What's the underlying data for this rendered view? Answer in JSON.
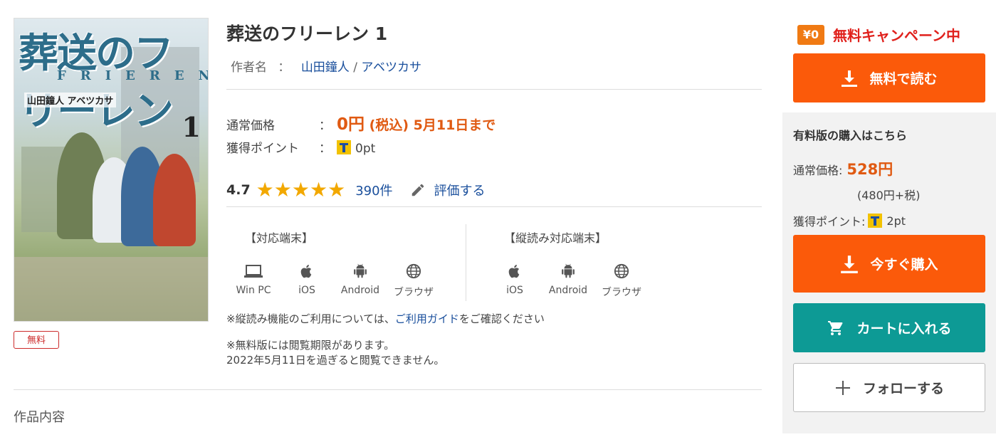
{
  "cover": {
    "title_text": "葬送のフリーレン",
    "title_en": "FRIEREN",
    "author_text": "山田鐘人 アベツカサ",
    "volume_text": "1"
  },
  "badge": {
    "free_label": "無料"
  },
  "book": {
    "title": "葬送のフリーレン 1",
    "author_label": "作者名",
    "author_colon": "：",
    "authors": [
      "山田鐘人",
      "アベツカサ"
    ],
    "author_sep": "/"
  },
  "price": {
    "label": "通常価格",
    "colon": "：",
    "value_main": "0円",
    "value_detail": "(税込) 5月11日まで"
  },
  "points": {
    "label": "獲得ポイント",
    "colon": "：",
    "value": "0pt"
  },
  "rating": {
    "score": "4.7",
    "stars": 4.7,
    "count": "390件",
    "rate_label": "評価する"
  },
  "devices": {
    "heading": "【対応端末】",
    "items": [
      {
        "icon": "laptop-icon",
        "label": "Win PC"
      },
      {
        "icon": "apple-icon",
        "label": "iOS"
      },
      {
        "icon": "android-icon",
        "label": "Android"
      },
      {
        "icon": "globe-icon",
        "label": "ブラウザ"
      }
    ]
  },
  "vertical_devices": {
    "heading": "【縦読み対応端末】",
    "items": [
      {
        "icon": "apple-icon",
        "label": "iOS"
      },
      {
        "icon": "android-icon",
        "label": "Android"
      },
      {
        "icon": "globe-icon",
        "label": "ブラウザ"
      }
    ]
  },
  "notes": {
    "vertical_prefix": "※縦読み機能のご利用については、",
    "guide_link": "ご利用ガイド",
    "vertical_suffix": "をご確認ください",
    "limit_line1": "※無料版には閲覧期限があります。",
    "limit_line2": "2022年5月11日を過ぎると閲覧できません。"
  },
  "content_section": {
    "title": "作品内容"
  },
  "campaign": {
    "badge": "¥0",
    "text": "無料キャンペーン中"
  },
  "buttons": {
    "read_free": "無料で読む",
    "buy_now": "今すぐ購入",
    "add_cart": "カートに入れる",
    "follow": "フォローする"
  },
  "paid": {
    "title": "有料版の購入はこちら",
    "price_label": "通常価格:",
    "price_value": "528円",
    "tax_note": "(480円+税)",
    "point_label": "獲得ポイント:",
    "point_value": "2pt"
  },
  "colors": {
    "accent_orange": "#fb5a0a",
    "teal": "#0d9a95",
    "price_red": "#e05a12",
    "campaign_red": "#e0201b",
    "link_blue": "#1a4f9c",
    "star": "#f2a800"
  }
}
